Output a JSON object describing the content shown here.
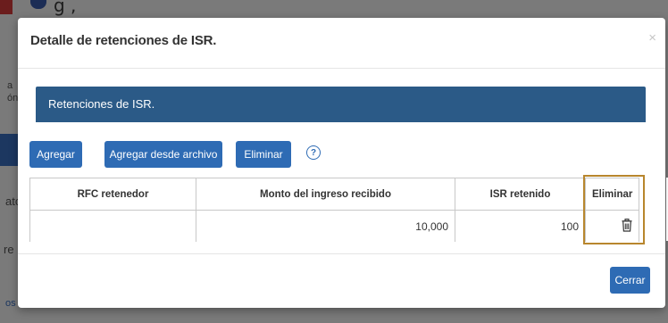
{
  "background": {
    "top_text": "g ,",
    "fragments": [
      "a",
      "ón",
      "atc",
      "re",
      "os"
    ]
  },
  "modal": {
    "title": "Detalle de retenciones de ISR.",
    "close_label": "×",
    "panel_heading": "Retenciones de ISR.",
    "toolbar": {
      "add_label": "Agregar",
      "add_from_file_label": "Agregar desde archivo",
      "delete_label": "Eliminar",
      "help_label": "?"
    },
    "table": {
      "headers": {
        "rfc": "RFC retenedor",
        "monto": "Monto del ingreso recibido",
        "isr": "ISR retenido",
        "eliminar": "Eliminar"
      },
      "rows": [
        {
          "rfc": "",
          "monto": "10,000",
          "isr": "100",
          "delete_icon": "trash-icon"
        }
      ],
      "highlighted_column": "Eliminar",
      "highlight_color": "#b8862d"
    },
    "close_button_label": "Cerrar"
  },
  "colors": {
    "primary": "#2e6bb4",
    "panel": "#2b5a87"
  }
}
